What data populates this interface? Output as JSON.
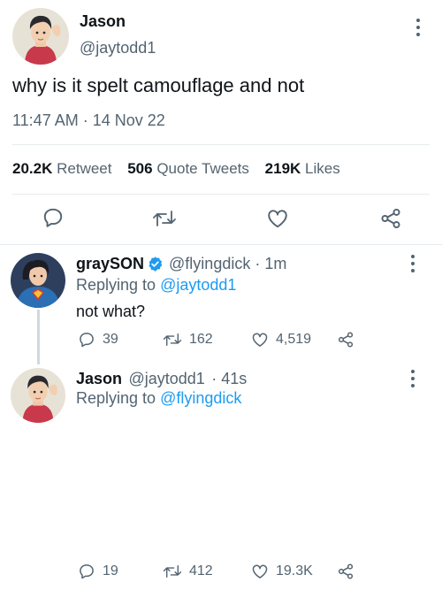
{
  "main_tweet": {
    "author_name": "Jason",
    "author_handle": "@jaytodd1",
    "text": "why is it spelt camouflage and not",
    "timestamp": "11:47 AM · 14 Nov 22",
    "stats": {
      "retweets_count": "20.2K",
      "retweets_label": "Retweet",
      "quotes_count": "506",
      "quotes_label": "Quote Tweets",
      "likes_count": "219K",
      "likes_label": "Likes"
    }
  },
  "reply1": {
    "author_name": "graySON",
    "verified": true,
    "author_handle": "@flyingdick",
    "time": "· 1m",
    "replying_prefix": "Replying to",
    "replying_to": "@jaytodd1",
    "text": "not what?",
    "replies": "39",
    "retweets": "162",
    "likes": "4,519"
  },
  "reply2": {
    "author_name": "Jason",
    "author_handle": "@jaytodd1",
    "time": "· 41s",
    "replying_prefix": "Replying to",
    "replying_to": "@flyingdick",
    "replies": "19",
    "retweets": "412",
    "likes": "19.3K"
  },
  "icons": {
    "reply": "reply-icon",
    "retweet": "retweet-icon",
    "like": "heart-icon",
    "share": "share-icon",
    "more": "more-options-icon",
    "verified": "verified-badge-icon"
  },
  "colors": {
    "link": "#1d9bf0",
    "muted": "#536471",
    "text": "#0f1419",
    "verified": "#1d9bf0",
    "divider": "#e6ecf0"
  }
}
